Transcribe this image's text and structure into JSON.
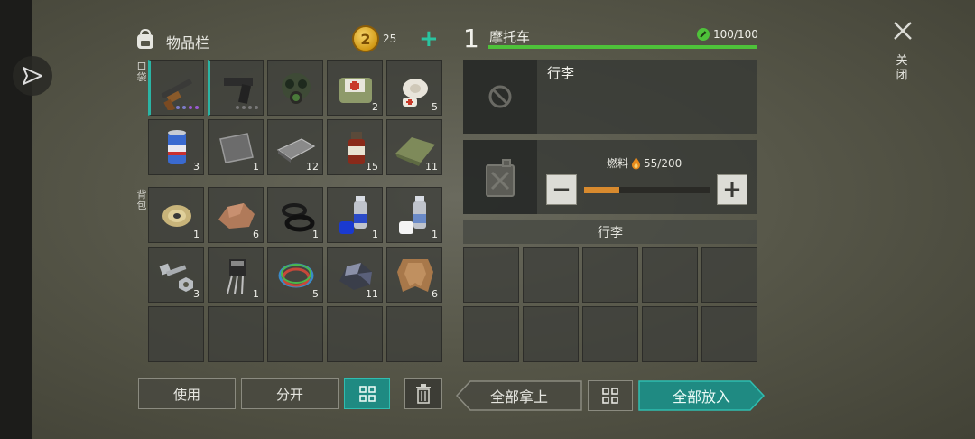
{
  "inventory": {
    "title": "物品栏",
    "coin_symbol": "2",
    "coins": "25",
    "add_symbol": "+",
    "pocket_label": "口袋",
    "backpack_label": "背包",
    "pocket": [
      {
        "icon": "shotgun",
        "count": "",
        "dots": [
          "#7c7cc8",
          "#7c7cc8",
          "#9a5ad2",
          "#9a5ad2"
        ],
        "selected": true
      },
      {
        "icon": "pistol",
        "count": "",
        "dots": [
          "#777",
          "#777",
          "#777",
          "#777"
        ],
        "selected": true
      },
      {
        "icon": "gas-mask",
        "count": ""
      },
      {
        "icon": "first-aid-bag",
        "count": "2"
      },
      {
        "icon": "bandage",
        "count": "5"
      },
      {
        "icon": "soda-can",
        "count": "3"
      },
      {
        "icon": "metal-plate",
        "count": "1"
      },
      {
        "icon": "iron-bar",
        "count": "12"
      },
      {
        "icon": "medicine-bottle",
        "count": "15"
      },
      {
        "icon": "cloth",
        "count": "11"
      }
    ],
    "backpack": [
      {
        "icon": "wire-spool",
        "count": "1"
      },
      {
        "icon": "stone",
        "count": "6"
      },
      {
        "icon": "rubber-rings",
        "count": "1"
      },
      {
        "icon": "blue-spray-paint",
        "count": "1"
      },
      {
        "icon": "white-spray-paint",
        "count": "1"
      },
      {
        "icon": "bolt-nut",
        "count": "3"
      },
      {
        "icon": "transistor",
        "count": "1"
      },
      {
        "icon": "wires",
        "count": "5"
      },
      {
        "icon": "ore",
        "count": "11"
      },
      {
        "icon": "leather",
        "count": "6"
      },
      {
        "icon": "",
        "count": ""
      },
      {
        "icon": "",
        "count": ""
      },
      {
        "icon": "",
        "count": ""
      },
      {
        "icon": "",
        "count": ""
      },
      {
        "icon": "",
        "count": ""
      }
    ]
  },
  "actions": {
    "use": "使用",
    "split": "分开",
    "take_all": "全部拿上",
    "put_all": "全部放入"
  },
  "vehicle": {
    "number": "1",
    "name": "摩托车",
    "hp": "100/100",
    "hp_fraction": 1.0,
    "luggage_label": "行李",
    "fuel_label": "燃料",
    "fuel_value": "55/200",
    "fuel_fraction": 0.275,
    "minus": "−",
    "plus": "+",
    "trunk_title": "行李",
    "trunk_slots": 10
  },
  "close_label": "关闭",
  "colors": {
    "accent_teal": "#1f8a82",
    "hp_green": "#4ec23a",
    "fuel_orange": "#d88a2e"
  }
}
